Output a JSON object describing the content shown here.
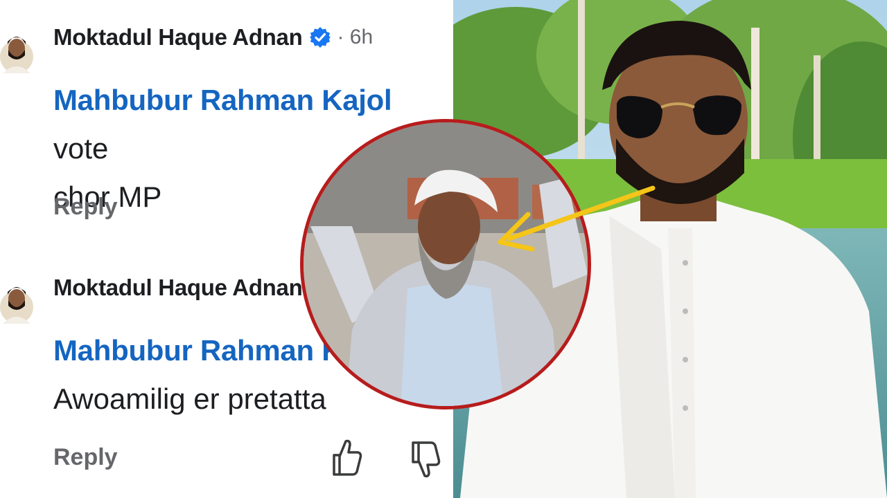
{
  "comments": [
    {
      "author": "Moktadul Haque Adnan",
      "time": "· 6h",
      "mention": "Mahbubur Rahman Kajol",
      "text_line1_suffix": " vote",
      "text_line2": "chor MP",
      "reply_label": "Reply"
    },
    {
      "author": "Moktadul Haque Adnan",
      "mention": "Mahbubur Rahman Kajol",
      "text_line2": "Awoamilig er pretatta",
      "reply_label": "Reply"
    }
  ],
  "icons": {
    "verified": "verified-badge-icon",
    "like": "thumbs-up-icon",
    "dislike": "thumbs-down-icon"
  },
  "colors": {
    "mention": "#1565c0",
    "verified": "#1877f2",
    "inset_border": "#b71c1c",
    "arrow": "#f5c518"
  }
}
